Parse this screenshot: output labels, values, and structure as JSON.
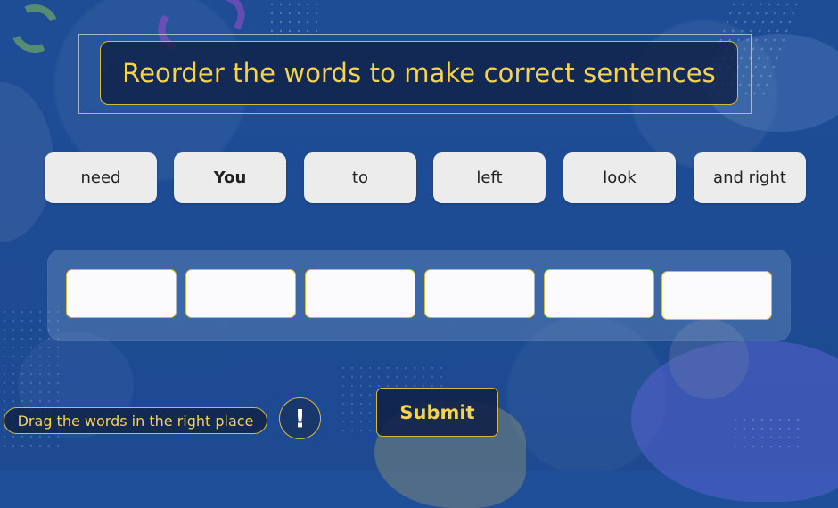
{
  "title": "Reorder the words to make correct sentences",
  "words": [
    {
      "label": "need"
    },
    {
      "label": "You"
    },
    {
      "label": "to"
    },
    {
      "label": "left"
    },
    {
      "label": "look"
    },
    {
      "label": "and right"
    }
  ],
  "hint": "Drag the words in the right place",
  "info_label": "!",
  "submit_label": "Submit"
}
